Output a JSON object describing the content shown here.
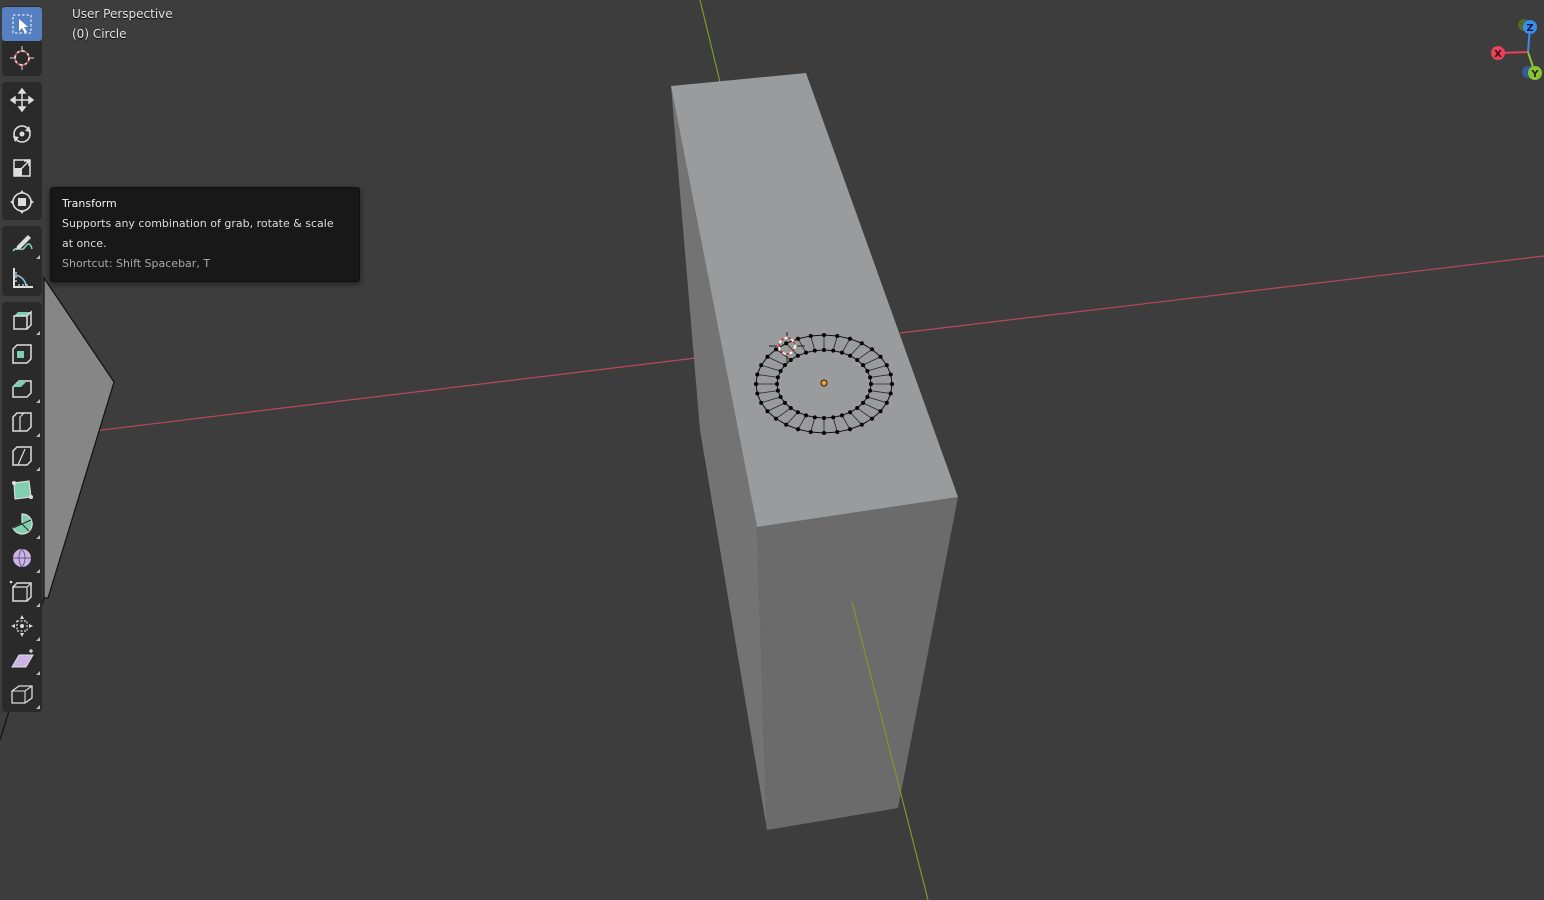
{
  "viewport": {
    "view_name": "User Perspective",
    "object_label": "(0) Circle"
  },
  "tooltip": {
    "title": "Transform",
    "description": "Supports any combination of grab, rotate & scale at once.",
    "shortcut": "Shortcut: Shift Spacebar, T"
  },
  "gizmo": {
    "x_label": "X",
    "y_label": "Y",
    "z_label": "Z",
    "x_color": "#e8435a",
    "y_color": "#8ac531",
    "z_color": "#3a8cf0"
  },
  "toolbar": {
    "groups": [
      [
        "select-box",
        "cursor"
      ],
      [
        "move",
        "rotate",
        "scale",
        "transform"
      ],
      [
        "annotate",
        "measure"
      ],
      [
        "extrude-region",
        "inset-faces",
        "bevel",
        "loop-cut",
        "knife",
        "poly-build",
        "spin",
        "smooth",
        "edge-slide",
        "shrink-fatten",
        "shear",
        "rip-region"
      ]
    ],
    "active": "select-box"
  },
  "colors": {
    "background": "#3d3d3d",
    "x_axis": "#b84a58",
    "y_axis": "#7a9a2a",
    "selection_accent": "#5680c2"
  }
}
